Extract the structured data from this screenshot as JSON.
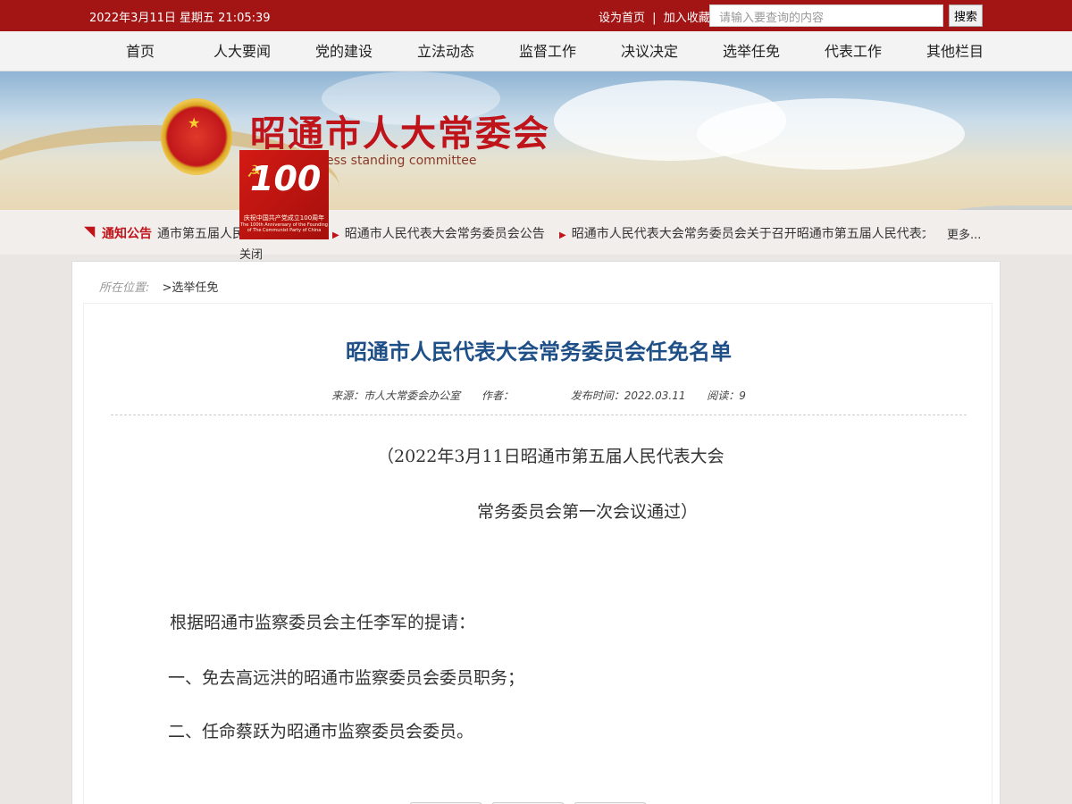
{
  "topbar": {
    "datetime": "2022年3月11日 星期五 21:05:39",
    "set_home": "设为首页",
    "bookmark": "加入收藏",
    "search_placeholder": "请输入要查询的内容",
    "search_button": "搜索"
  },
  "nav": {
    "items": [
      "首页",
      "人大要闻",
      "党的建设",
      "立法动态",
      "监督工作",
      "决议决定",
      "选举任免",
      "代表工作",
      "其他栏目"
    ]
  },
  "banner": {
    "title": "昭通市人大常委会",
    "subtitle": "ople's congress standing committee"
  },
  "float_ad": {
    "number": "100",
    "caption_cn": "庆祝中国共产党成立100周年",
    "caption_en": "The 100th Anniversary of the Founding of The Communist Party of China",
    "close": "关闭"
  },
  "notice": {
    "label": "通知公告",
    "items": [
      "通市第五届人民",
      "昭通市人民代表大会常务委员会公告",
      "昭通市人民代表大会常务委员会关于召开昭通市第五届人民代表大"
    ],
    "more": "更多..."
  },
  "breadcrumb": {
    "prefix": "所在位置:",
    "current": ">选举任免"
  },
  "article": {
    "title": "昭通市人民代表大会常务委员会任免名单",
    "source": "来源：市人大常委会办公室",
    "author": "作者：",
    "published": "发布时间：2022.03.11",
    "views": "阅读：9",
    "lines": [
      "（2022年3月11日昭通市第五届人民代表大会",
      "常务委员会第一次会议通过）",
      "根据昭通市监察委员会主任李军的提请：",
      "一、免去高远洪的昭通市监察委员会委员职务；",
      "二、任命蔡跃为昭通市监察委员会委员。"
    ]
  },
  "colors": {
    "brand_red": "#a31515",
    "title_blue": "#1e4f86"
  }
}
